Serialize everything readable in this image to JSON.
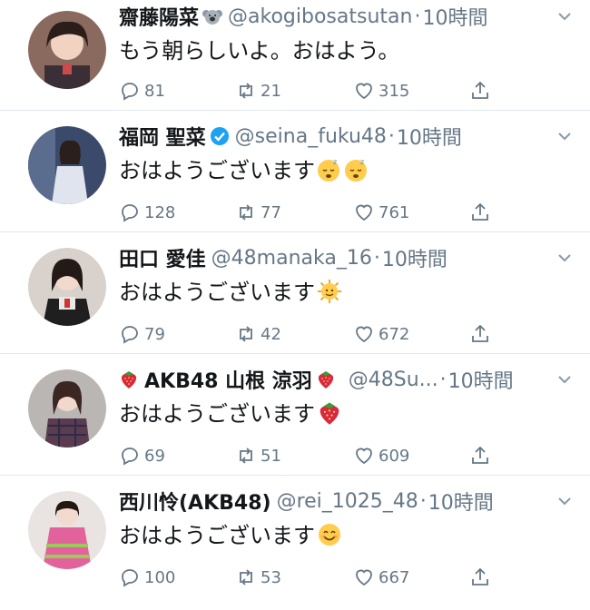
{
  "tweets": [
    {
      "name": "齋藤陽菜",
      "name_emoji": "koala",
      "handle": "@akogibosatsutan",
      "dot": "·",
      "time": "10時間",
      "text": "もう朝らしいよ。おはよう。",
      "emojis": [],
      "replies": "81",
      "retweets": "21",
      "likes": "315",
      "verified": false
    },
    {
      "name": "福岡 聖菜",
      "name_emoji": "",
      "handle": "@seina_fuku48",
      "dot": "·",
      "time": "10時間",
      "text": "おはようございます",
      "emojis": [
        "sleeping-face",
        "sleeping-face"
      ],
      "replies": "128",
      "retweets": "77",
      "likes": "761",
      "verified": true
    },
    {
      "name": "田口 愛佳",
      "name_emoji": "",
      "handle": "@48manaka_16",
      "dot": "·",
      "time": "10時間",
      "text": "おはようございます",
      "emojis": [
        "sun-face"
      ],
      "replies": "79",
      "retweets": "42",
      "likes": "672",
      "verified": false
    },
    {
      "name": "AKB48 山根 涼羽",
      "name_emoji": "strawberry",
      "handle": "@48Su...",
      "dot": "·",
      "time": "10時間",
      "text": "おはようございます",
      "emojis": [
        "strawberry"
      ],
      "replies": "69",
      "retweets": "51",
      "likes": "609",
      "verified": false
    },
    {
      "name": "西川怜(AKB48)",
      "name_emoji": "",
      "handle": "@rei_1025_48",
      "dot": "·",
      "time": "10時間",
      "text": "おはようございます",
      "emojis": [
        "smiling-face"
      ],
      "replies": "100",
      "retweets": "53",
      "likes": "667",
      "verified": false
    }
  ],
  "colors": {
    "text": "#14171a",
    "secondary": "#657786",
    "divider": "#e1e8ed",
    "verified": "#1da1f2"
  }
}
